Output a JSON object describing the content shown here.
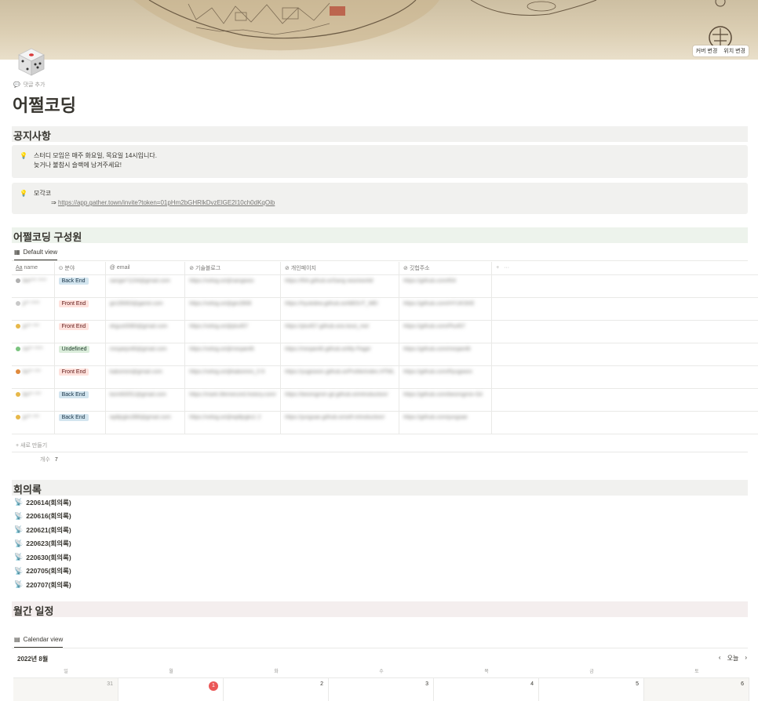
{
  "cover": {
    "change_cover": "커버 변경",
    "reposition": "위치 변경"
  },
  "page": {
    "icon": "dice-icon",
    "add_comment": "댓글 추가",
    "title": "어쩔코딩"
  },
  "notice": {
    "heading": "공지사항",
    "callouts": [
      {
        "line1": "스터디 모임은 매주 화요일, 목요일 14시입니다.",
        "line2": "늦거나 불참시 슬랙에 남겨주세요!"
      },
      {
        "line1": "모각코",
        "arrow": "⇒",
        "link": "https://app.gather.town/invite?token=01pHm2bGHRlkDvzElGE2I10ch0dKqOib"
      }
    ]
  },
  "members": {
    "heading": "어쩔코딩 구성원",
    "view_label": "Default view",
    "columns": [
      "name",
      "분야",
      "email",
      "기술블로그",
      "개인페이지",
      "깃헙주소"
    ],
    "add_column": "+",
    "more": "···",
    "rows": [
      {
        "name": "lee*** ****",
        "field": "Back End",
        "tag": "blue",
        "email": "sangw*1104@gmail.com",
        "blog": "https://velog.io/@sangwoo",
        "page": "https://f04.github.io/Sang woo/world/",
        "github": "https://github.com/f04"
      },
      {
        "name": "ji** ****",
        "field": "Front End",
        "tag": "red",
        "email": "gin28083@gamil.com",
        "blog": "https://velog.io/@gin2808",
        "page": "https://hyukdew.github.io/ABOUT_ME/",
        "github": "https://github.com/HYUKSKE"
      },
      {
        "name": "jo** ***",
        "field": "Front End",
        "tag": "red",
        "email": "ekguo0080@gmail.com",
        "blog": "https://velog.io/@plu457",
        "page": "https://plu457.github.io/a bout_me/",
        "github": "https://github.com/Plu457"
      },
      {
        "name": "mi** ****",
        "field": "Undefined",
        "tag": "green",
        "email": "minjaejo46@gmail.com",
        "blog": "https://velog.io/@minjae46",
        "page": "https://minjae46.github.io/My-Page/",
        "github": "https://github.com/minjae46"
      },
      {
        "name": "ko** ***",
        "field": "Front End",
        "tag": "red",
        "email": "kabomini@gmail.com",
        "blog": "https://velog.io/@kabomini_0 9",
        "page": "https://yugiswon.github.io/Profile/index.HTML",
        "github": "https://github.com/Ryugiwon"
      },
      {
        "name": "bo** ***",
        "field": "Back End",
        "tag": "blue",
        "email": "bom60051@gmail.com",
        "blog": "https://mark.Memecord.history.com/",
        "page": "https://beomgmin-gil.github.io/introduction/",
        "github": "https://github.com/beomgmin-Gil"
      },
      {
        "name": "jo** ***",
        "field": "Back End",
        "tag": "blue",
        "email": "wjdtjrgks388@gmail.com",
        "blog": "https://velog.io/@wjdtjrgks1 2",
        "page": "https://jungsae.github.io/self-introduction/",
        "github": "https://github.com/jungsae"
      }
    ],
    "new_row": "+ 새로 만들기",
    "count_label": "개수",
    "count_value": "7"
  },
  "minutes": {
    "heading": "회의록",
    "items": [
      "220614(회의록)",
      "220616(회의록)",
      "220621(회의록)",
      "220623(회의록)",
      "220630(회의록)",
      "220705(회의록)",
      "220707(회의록)"
    ]
  },
  "calendar": {
    "heading": "월간 일정",
    "view_label": "Calendar view",
    "month": "2022년 8월",
    "today_label": "오늘",
    "weekdays": [
      "일",
      "월",
      "화",
      "수",
      "목",
      "금",
      "토"
    ],
    "days": [
      "31",
      "1",
      "2",
      "3",
      "4",
      "5",
      "6"
    ],
    "today_index": 1
  },
  "colors": {
    "today": "#eb5757",
    "callout_bg": "#f1f1ef",
    "green_header": "#edf3ec"
  }
}
